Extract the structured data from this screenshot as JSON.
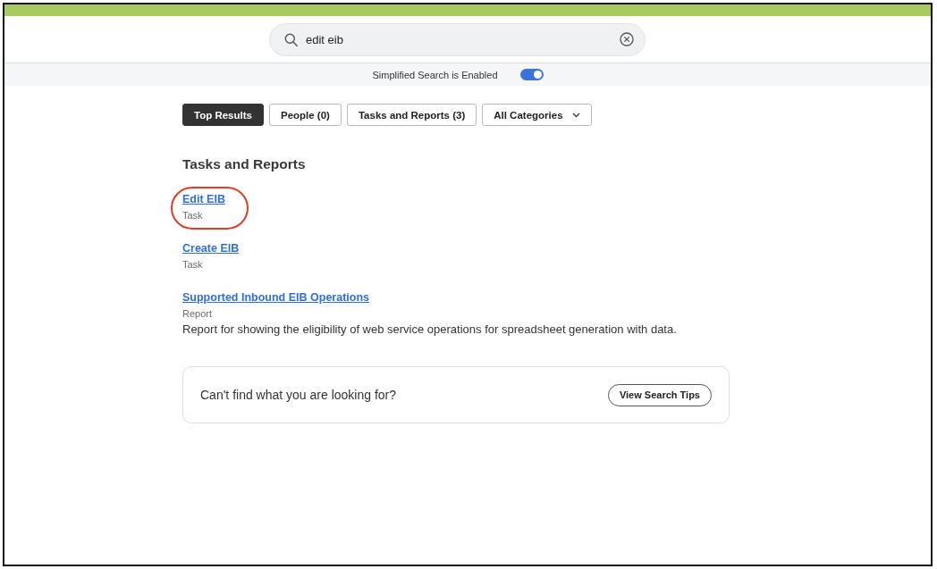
{
  "search": {
    "value": "edit eib"
  },
  "simplified_search": {
    "label": "Simplified Search is Enabled",
    "on": true
  },
  "tabs": [
    {
      "label": "Top Results",
      "selected": true
    },
    {
      "label": "People (0)",
      "selected": false
    },
    {
      "label": "Tasks and Reports (3)",
      "selected": false
    }
  ],
  "category_filter": {
    "value": "All Categories"
  },
  "section": {
    "heading": "Tasks and Reports",
    "results": [
      {
        "title": "Edit EIB",
        "type": "Task",
        "circled": true
      },
      {
        "title": "Create EIB",
        "type": "Task",
        "circled": false
      },
      {
        "title": "Supported Inbound EIB Operations",
        "type": "Report",
        "description": "Report for showing the eligibility of web service operations for spreadsheet generation with data.",
        "circled": false
      }
    ]
  },
  "help_card": {
    "text": "Can't find what you are looking for?",
    "button": "View Search Tips"
  }
}
